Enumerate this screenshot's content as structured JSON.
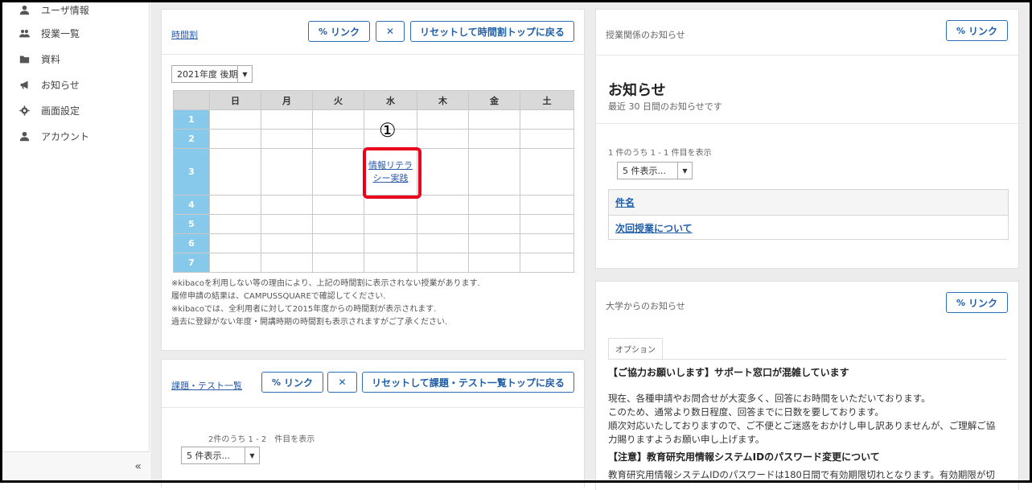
{
  "sidebar": {
    "items": [
      {
        "label": "ユーザ情報",
        "icon": "user-icon"
      },
      {
        "label": "授業一覧",
        "icon": "users-icon"
      },
      {
        "label": "資料",
        "icon": "folder-icon"
      },
      {
        "label": "お知らせ",
        "icon": "bullhorn-icon"
      },
      {
        "label": "画面設定",
        "icon": "gear-icon"
      },
      {
        "label": "アカウント",
        "icon": "user-icon"
      }
    ],
    "collapse_label": "«"
  },
  "timetable": {
    "title": "時間割",
    "link_button": "リンク",
    "reset_button": "リセットして時間割トップに戻る",
    "term_select": "2021年度 後期",
    "days": [
      "日",
      "月",
      "火",
      "水",
      "木",
      "金",
      "土"
    ],
    "periods": [
      "1",
      "2",
      "3",
      "4",
      "5",
      "6",
      "7"
    ],
    "course": {
      "period": "3",
      "day": "水",
      "name": "情報リテラシー実践"
    },
    "annotation": "①",
    "notes": [
      "※kibacoを利用しない等の理由により、上記の時間割に表示されない授業があります.",
      "履修申請の結果は、CAMPUSSQUAREで確認してください.",
      "※kibacoでは、全利用者に対して2015年度からの時間割が表示されます.",
      "過去に登録がない年度・開講時期の時間割も表示されますがご了承ください."
    ]
  },
  "tasks": {
    "title": "課題・テスト一覧",
    "link_button": "リンク",
    "reset_button": "リセットして課題・テスト一覧トップに戻る",
    "count_text": "2件のうち 1 - 2　件目を表示",
    "page_size": "5 件表示..."
  },
  "class_notices": {
    "title": "授業関係のお知らせ",
    "link_button": "リンク",
    "heading": "お知らせ",
    "subtitle": "最近 30 日間のお知らせです",
    "count_text": "1 件のうち 1 - 1 件目を表示",
    "page_size": "5 件表示...",
    "column_header": "件名",
    "rows": [
      "次回授業について"
    ]
  },
  "univ_notices": {
    "title": "大学からのお知らせ",
    "link_button": "リンク",
    "option_tab": "オプション",
    "headline1": "【ご協力お願いします】サポート窓口が混雑しています",
    "body_lines": [
      "現在、各種申請やお問合せが大変多く、回答にお時間をいただいております。",
      "このため、通常より数日程度、回答までに日数を要しております。",
      "順次対応いたしておりますので、ご不便とご迷惑をおかけし申し訳ありませんが、ご理解ご協",
      "力賜りますようお願い申し上げます。"
    ],
    "headline2": "【注意】教育研究用情報システムIDのパスワード変更について",
    "cut_line": "教育研究用情報システムIDのパスワードは180日間で有効期限切れとなります。有効期限が切"
  },
  "colors": {
    "accent": "#2d6fb3",
    "period_bg": "#86c9ea",
    "highlight": "#e8001c"
  }
}
